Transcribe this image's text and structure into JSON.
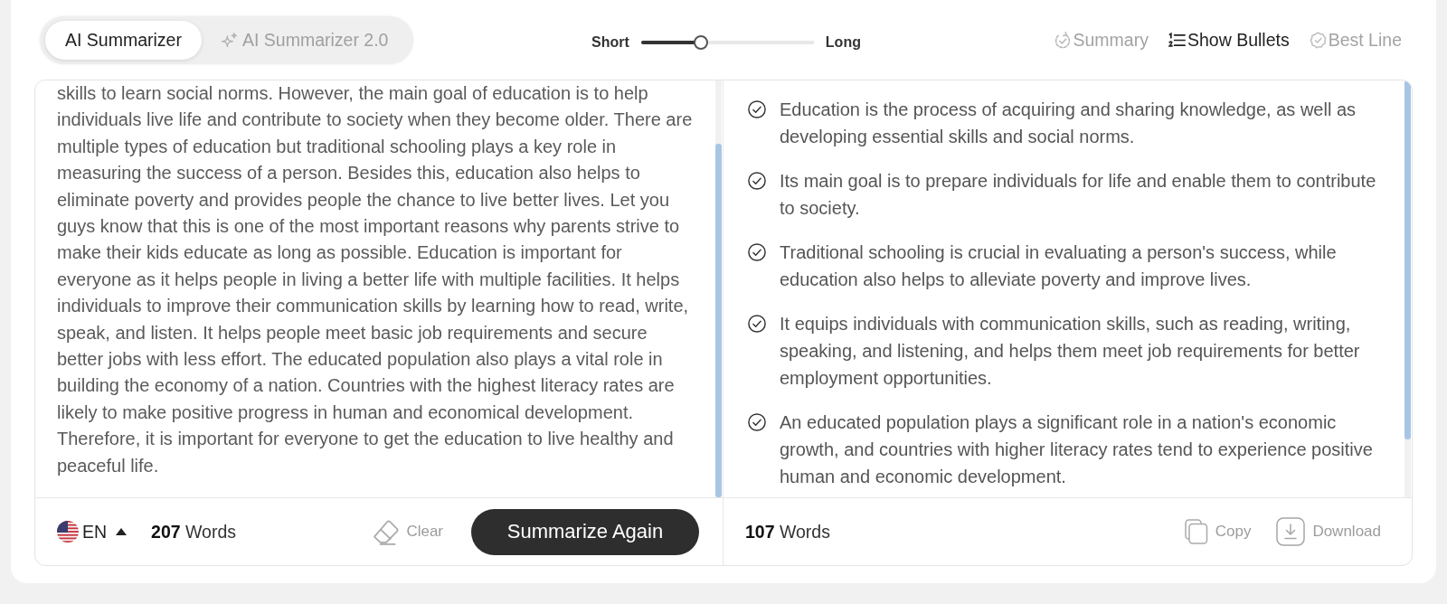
{
  "tabs": [
    {
      "label": "AI Summarizer",
      "selected": true,
      "kind": "plain"
    },
    {
      "label": "AI Summarizer 2.0",
      "selected": false,
      "kind": "sparkle"
    }
  ],
  "length_slider": {
    "min_label": "Short",
    "max_label": "Long",
    "level": 0.33
  },
  "view_modes": [
    {
      "label": "Summary",
      "selected": false,
      "kind": "summary"
    },
    {
      "label": "Show Bullets",
      "selected": true,
      "kind": "bullets"
    },
    {
      "label": "Best Line",
      "selected": false,
      "kind": "best_line"
    }
  ],
  "input_panel": {
    "text": "skills to learn social norms. However, the main goal of education is to help individuals live life and contribute to society when they become older. There are multiple types of education but traditional schooling plays a key role in measuring the success of a person. Besides this, education also helps to eliminate poverty and provides people the chance to live better lives. Let you guys know that this is one of the most important reasons why parents strive to make their kids educate as long as possible. Education is important for everyone as it helps people in living a better life with multiple facilities. It helps individuals to improve their communication skills by learning how to read, write, speak, and listen. It helps people meet basic job requirements and secure better jobs with less effort. The educated population also plays a vital role in building the economy of a nation. Countries with the highest literacy rates are likely to make positive progress in human and economical development. Therefore, it is important for everyone to get the education to live healthy and peaceful life.",
    "language": "EN",
    "word_count": "**207** Words",
    "clear_label": "Clear",
    "submit_label": "Summarize Again"
  },
  "output_panel": {
    "bullets": [
      "Education is the process of acquiring and sharing knowledge, as well as developing essential skills and social norms.",
      "Its main goal is to prepare individuals for life and enable them to contribute to society.",
      "Traditional schooling is crucial in evaluating a person's success, while education also helps to alleviate poverty and improve lives.",
      "It equips individuals with communication skills, such as reading, writing, speaking, and listening, and helps them meet job requirements for better employment opportunities.",
      "An educated population plays a significant role in a nation's economic growth, and countries with higher literacy rates tend to experience positive human and economic development."
    ],
    "word_count": "**107** Words",
    "actions": [
      {
        "kind": "copy",
        "label": "Copy"
      },
      {
        "kind": "download",
        "label": "Download"
      }
    ]
  }
}
